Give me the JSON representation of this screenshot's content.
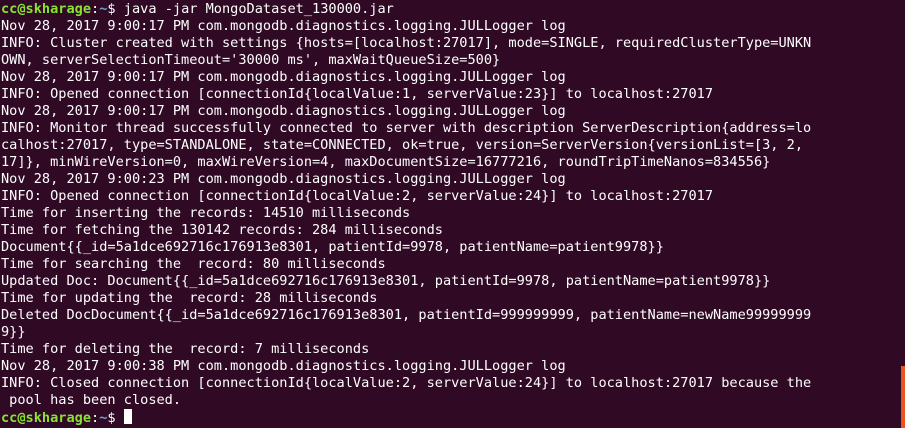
{
  "colors": {
    "background": "#300a24",
    "text": "#ffffff",
    "prompt_user": "#8ae234",
    "prompt_path": "#729fcf",
    "scroll_marker": "#e95420"
  },
  "prompt": {
    "user_host": "cc@skharage",
    "separator": ":",
    "path": "~",
    "symbol": "$ ",
    "command": "java -jar MongoDataset_130000.jar"
  },
  "output_lines": [
    "Nov 28, 2017 9:00:17 PM com.mongodb.diagnostics.logging.JULLogger log",
    "INFO: Cluster created with settings {hosts=[localhost:27017], mode=SINGLE, requiredClusterType=UNKN",
    "OWN, serverSelectionTimeout='30000 ms', maxWaitQueueSize=500}",
    "Nov 28, 2017 9:00:17 PM com.mongodb.diagnostics.logging.JULLogger log",
    "INFO: Opened connection [connectionId{localValue:1, serverValue:23}] to localhost:27017",
    "Nov 28, 2017 9:00:17 PM com.mongodb.diagnostics.logging.JULLogger log",
    "INFO: Monitor thread successfully connected to server with description ServerDescription{address=lo",
    "calhost:27017, type=STANDALONE, state=CONNECTED, ok=true, version=ServerVersion{versionList=[3, 2,",
    "17]}, minWireVersion=0, maxWireVersion=4, maxDocumentSize=16777216, roundTripTimeNanos=834556}",
    "Nov 28, 2017 9:00:23 PM com.mongodb.diagnostics.logging.JULLogger log",
    "INFO: Opened connection [connectionId{localValue:2, serverValue:24}] to localhost:27017",
    "Time for inserting the records: 14510 milliseconds",
    "Time for fetching the 130142 records: 284 milliseconds",
    "Document{{_id=5a1dce692716c176913e8301, patientId=9978, patientName=patient9978}}",
    "Time for searching the  record: 80 milliseconds",
    "Updated Doc: Document{{_id=5a1dce692716c176913e8301, patientId=9978, patientName=patient9978}}",
    "Time for updating the  record: 28 milliseconds",
    "Deleted DocDocument{{_id=5a1dce692716c176913e8301, patientId=999999999, patientName=newName99999999",
    "9}}",
    "Time for deleting the  record: 7 milliseconds",
    "Nov 28, 2017 9:00:38 PM com.mongodb.diagnostics.logging.JULLogger log",
    "INFO: Closed connection [connectionId{localValue:2, serverValue:24}] to localhost:27017 because the",
    " pool has been closed."
  ],
  "final_prompt": {
    "user_host": "cc@skharage",
    "separator": ":",
    "path": "~",
    "symbol": "$ "
  }
}
